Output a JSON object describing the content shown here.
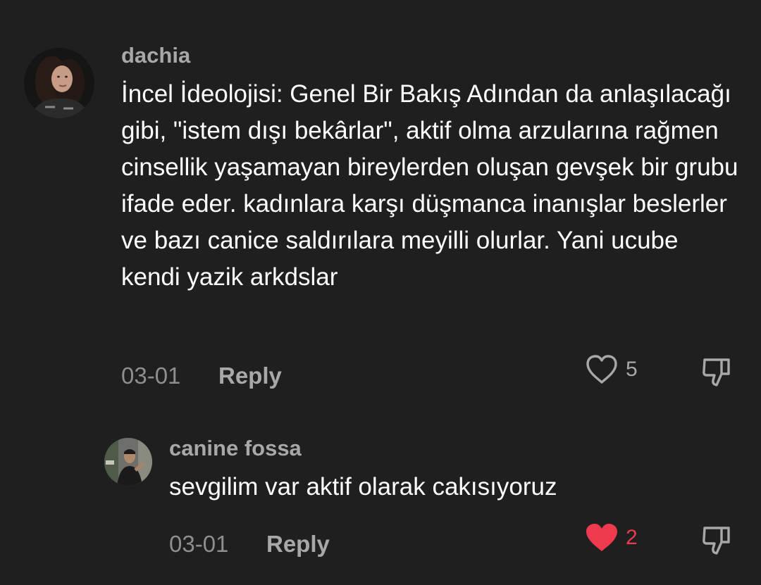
{
  "comments": [
    {
      "username": "dachia",
      "text": "İncel İdeolojisi: Genel Bir Bakış Adından da anlaşılacağı gibi, \"istem dışı bekârlar\", aktif olma arzularına rağmen cinsellik yaşamayan bireylerden oluşan gevşek bir grubu ifade eder. kadınlara karşı düşmanca inanışlar beslerler ve bazı canice saldırılara meyilli olurlar. Yani ucube kendi yazik arkdslar",
      "date": "03-01",
      "reply_label": "Reply",
      "like_count": "5",
      "liked": false
    }
  ],
  "replies": [
    {
      "username": "canine fossa",
      "text": "sevgilim var aktif olarak cakısıyoruz",
      "date": "03-01",
      "reply_label": "Reply",
      "like_count": "2",
      "liked": true
    }
  ],
  "colors": {
    "background": "#1f1f1f",
    "username": "#a8a8a8",
    "meta": "#8e8e8e",
    "like_active": "#ee3a4f",
    "icon": "#a8a8a8"
  },
  "icons": {
    "like": "heart-outline-icon",
    "liked": "heart-filled-icon",
    "dislike": "thumbs-down-icon"
  }
}
